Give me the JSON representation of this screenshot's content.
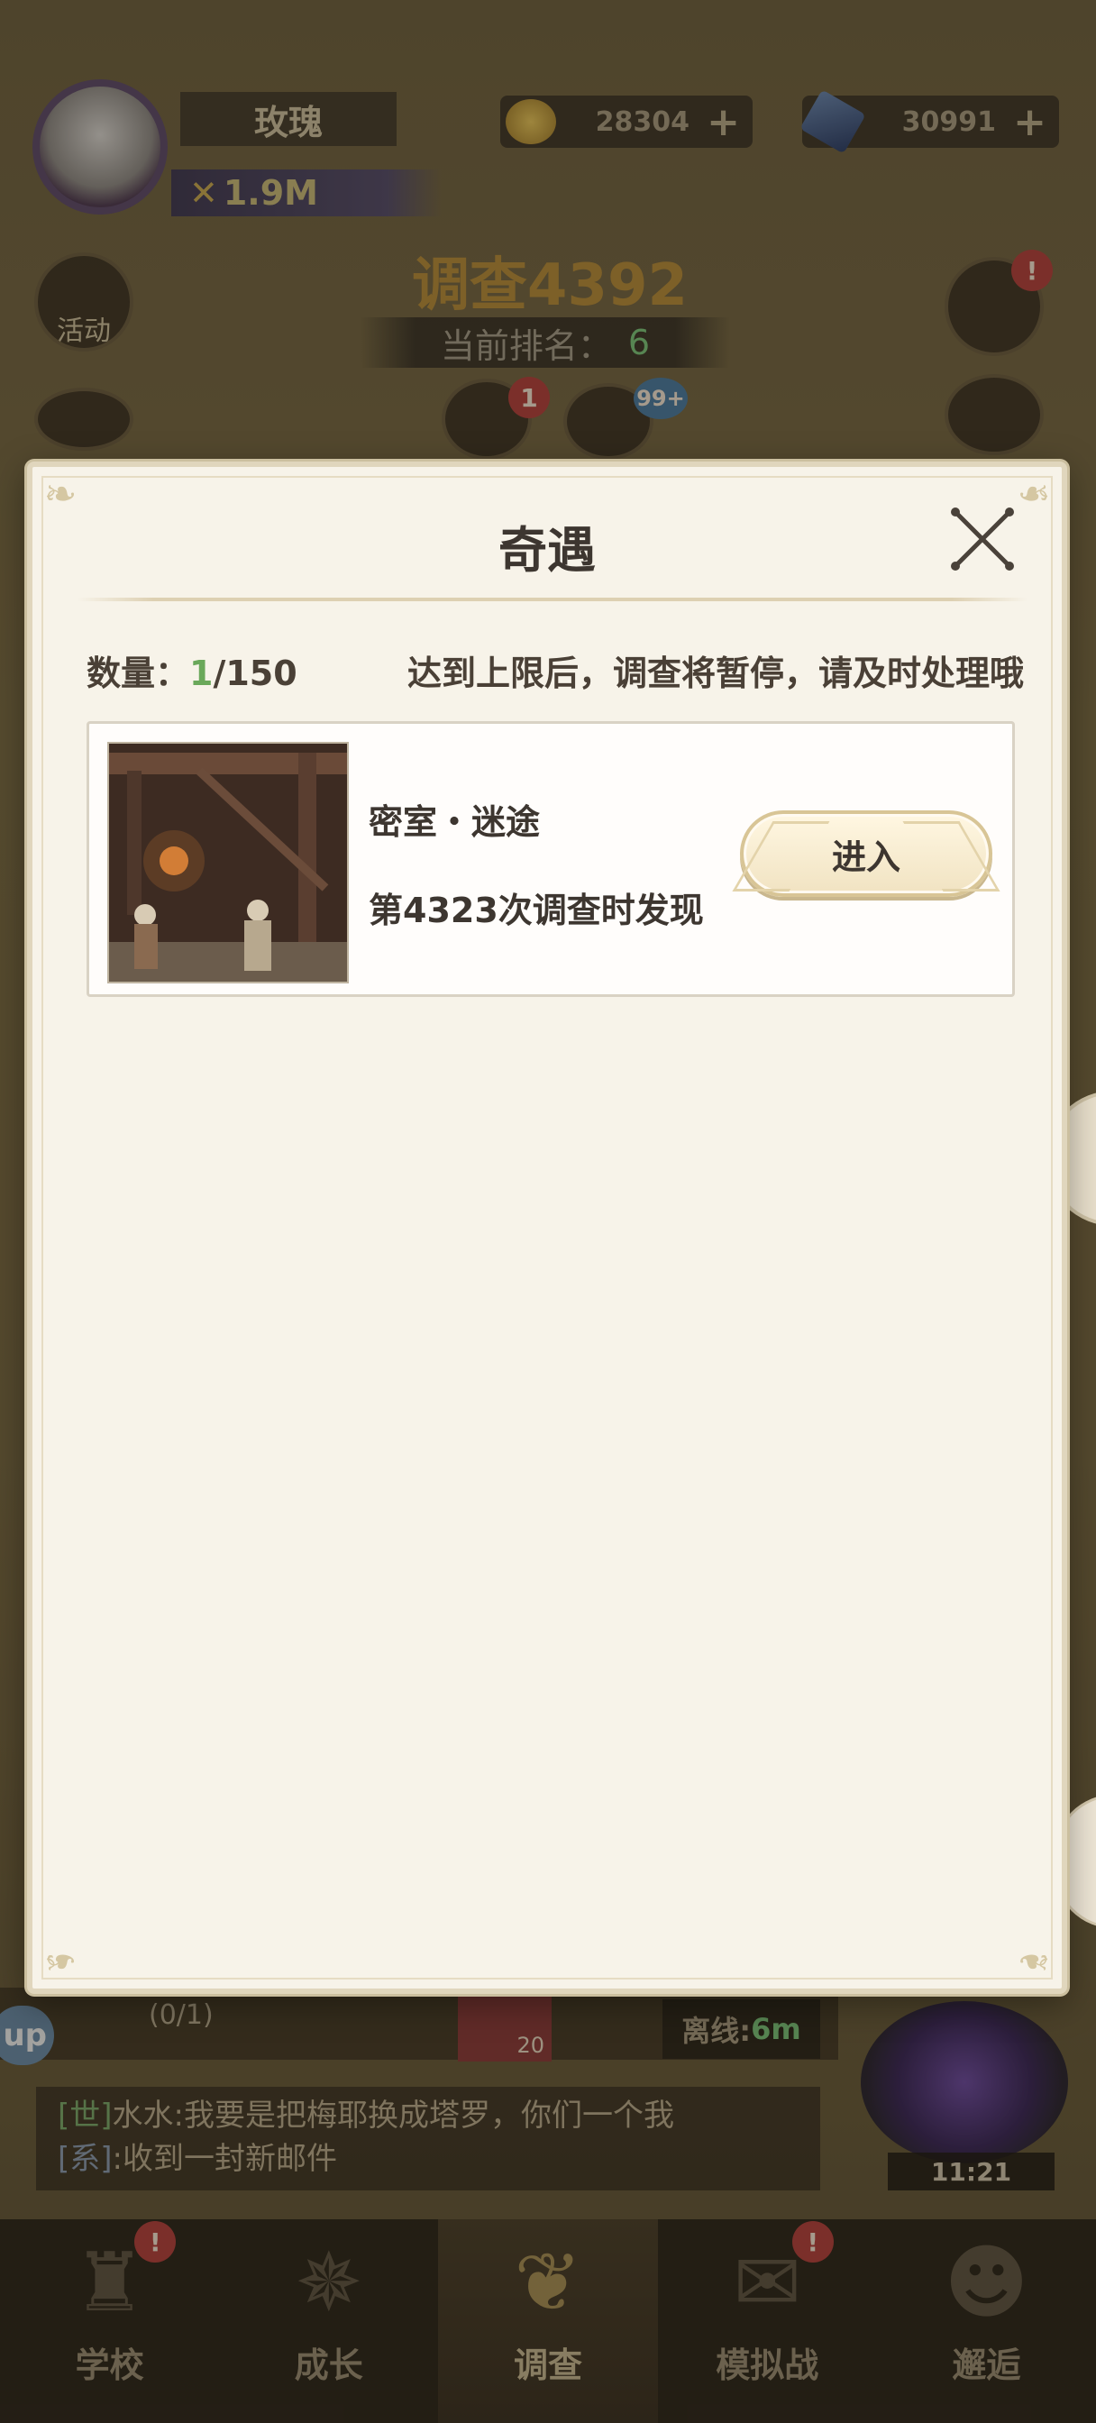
{
  "player": {
    "name": "玫瑰",
    "power": "1.9M"
  },
  "currencies": [
    {
      "icon": "gold-ore-icon",
      "value": "28304"
    },
    {
      "icon": "crystal-icon",
      "value": "30991"
    }
  ],
  "stage": {
    "title": "调查4392",
    "rank_label": "当前排名：",
    "rank_value": "6"
  },
  "side_buttons": {
    "activity_label": "活动",
    "book_badge": "1",
    "telescope_badge": "99+",
    "shop_badge": "!"
  },
  "modal": {
    "title": "奇遇",
    "count_label": "数量：",
    "count_current": "1",
    "count_total": "/150",
    "limit_notice": "达到上限后，调查将暂停，请及时处理哦",
    "events": [
      {
        "name": "密室・迷途",
        "found": "第4323次调查时发现",
        "enter_label": "进入"
      }
    ]
  },
  "bottom": {
    "quest_progress": "(0/1)",
    "quest_item_count": "20",
    "offline_label": "离线:",
    "offline_value": "6m",
    "left_pill": "up",
    "chat": [
      {
        "tag": "[世]",
        "text": "水水:我要是把梅耶换成塔罗，你们一个我"
      },
      {
        "tag": "[系]",
        "text": ":收到一封新邮件"
      }
    ],
    "clock": "11:21"
  },
  "tabs": [
    {
      "label": "学校",
      "icon": "castle-icon",
      "badge": "!",
      "active": false
    },
    {
      "label": "成长",
      "icon": "compass-icon",
      "badge": "",
      "active": false
    },
    {
      "label": "调查",
      "icon": "emblem-icon",
      "badge": "",
      "active": true
    },
    {
      "label": "模拟战",
      "icon": "scroll-icon",
      "badge": "!",
      "active": false
    },
    {
      "label": "邂逅",
      "icon": "character-icon",
      "badge": "",
      "active": false
    }
  ],
  "colors": {
    "modal_bg": "#f7f3e9",
    "accent_green": "#6aa85a",
    "badge_red": "#b3403c"
  }
}
